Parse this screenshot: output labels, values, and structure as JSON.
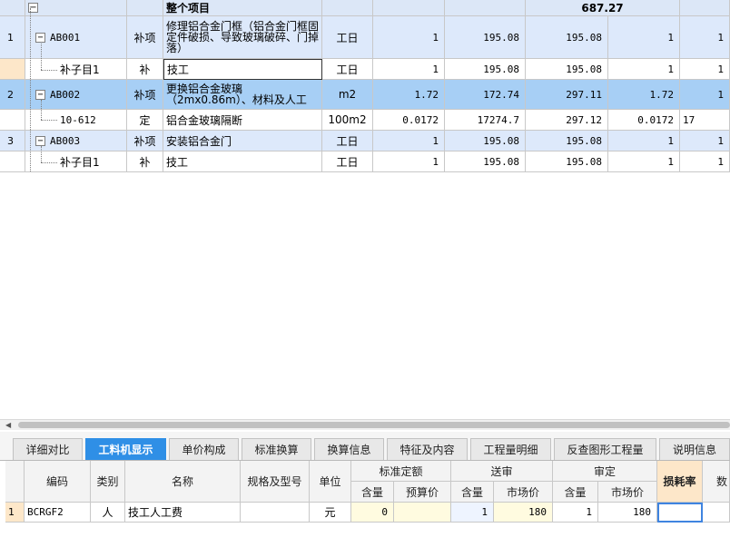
{
  "grid": {
    "total_row": {
      "label": "整个项目",
      "amount": "687.27"
    },
    "rows": [
      {
        "num": "1",
        "code": "AB001",
        "type": "补项",
        "name": "修理铝合金门框（铝合金门框固定件破损、导致玻璃破碎、门掉落）",
        "unit": "工日",
        "qty": "1",
        "price": "195.08",
        "total": "195.08",
        "qty2": "1",
        "extra": "1"
      },
      {
        "num": "",
        "code": "补子目1",
        "type": "补",
        "name": "技工",
        "unit": "工日",
        "qty": "1",
        "price": "195.08",
        "total": "195.08",
        "qty2": "1",
        "extra": "1"
      },
      {
        "num": "2",
        "code": "AB002",
        "type": "补项",
        "name": "更换铝合金玻璃（2mx0.86m）、材料及人工",
        "unit": "m2",
        "qty": "1.72",
        "price": "172.74",
        "total": "297.11",
        "qty2": "1.72",
        "extra": "1"
      },
      {
        "num": "",
        "code": "10-612",
        "type": "定",
        "name": "铝合金玻璃隔断",
        "unit": "100m2",
        "qty": "0.0172",
        "price": "17274.7",
        "total": "297.12",
        "qty2": "0.0172",
        "extra": "17"
      },
      {
        "num": "3",
        "code": "AB003",
        "type": "补项",
        "name": "安装铝合金门",
        "unit": "工日",
        "qty": "1",
        "price": "195.08",
        "total": "195.08",
        "qty2": "1",
        "extra": "1"
      },
      {
        "num": "",
        "code": "补子目1",
        "type": "补",
        "name": "技工",
        "unit": "工日",
        "qty": "1",
        "price": "195.08",
        "total": "195.08",
        "qty2": "1",
        "extra": "1"
      }
    ]
  },
  "tabs": [
    "详细对比",
    "工料机显示",
    "单价构成",
    "标准换算",
    "换算信息",
    "特征及内容",
    "工程量明细",
    "反查图形工程量",
    "说明信息"
  ],
  "bottom": {
    "headers": {
      "code": "编码",
      "type": "类别",
      "name": "名称",
      "spec": "规格及型号",
      "unit": "单位",
      "standard": "标准定额",
      "submit": "送审",
      "approve": "审定",
      "content": "含量",
      "budget_price": "预算价",
      "market_price": "市场价",
      "loss_rate": "损耗率",
      "extra": "数"
    },
    "row": {
      "num": "1",
      "code": "BCRGF2",
      "type": "人",
      "name": "技工人工费",
      "spec": "",
      "unit": "元",
      "std_content": "0",
      "std_budget": "",
      "sub_content": "1",
      "sub_market": "180",
      "app_content": "1",
      "app_market": "180",
      "loss_rate": ""
    }
  },
  "colors": {
    "active_tab": "#2f8fe6",
    "row_light": "#dde9fb",
    "row_selected": "#a7cff5",
    "loss_header": "#fde7c9"
  }
}
